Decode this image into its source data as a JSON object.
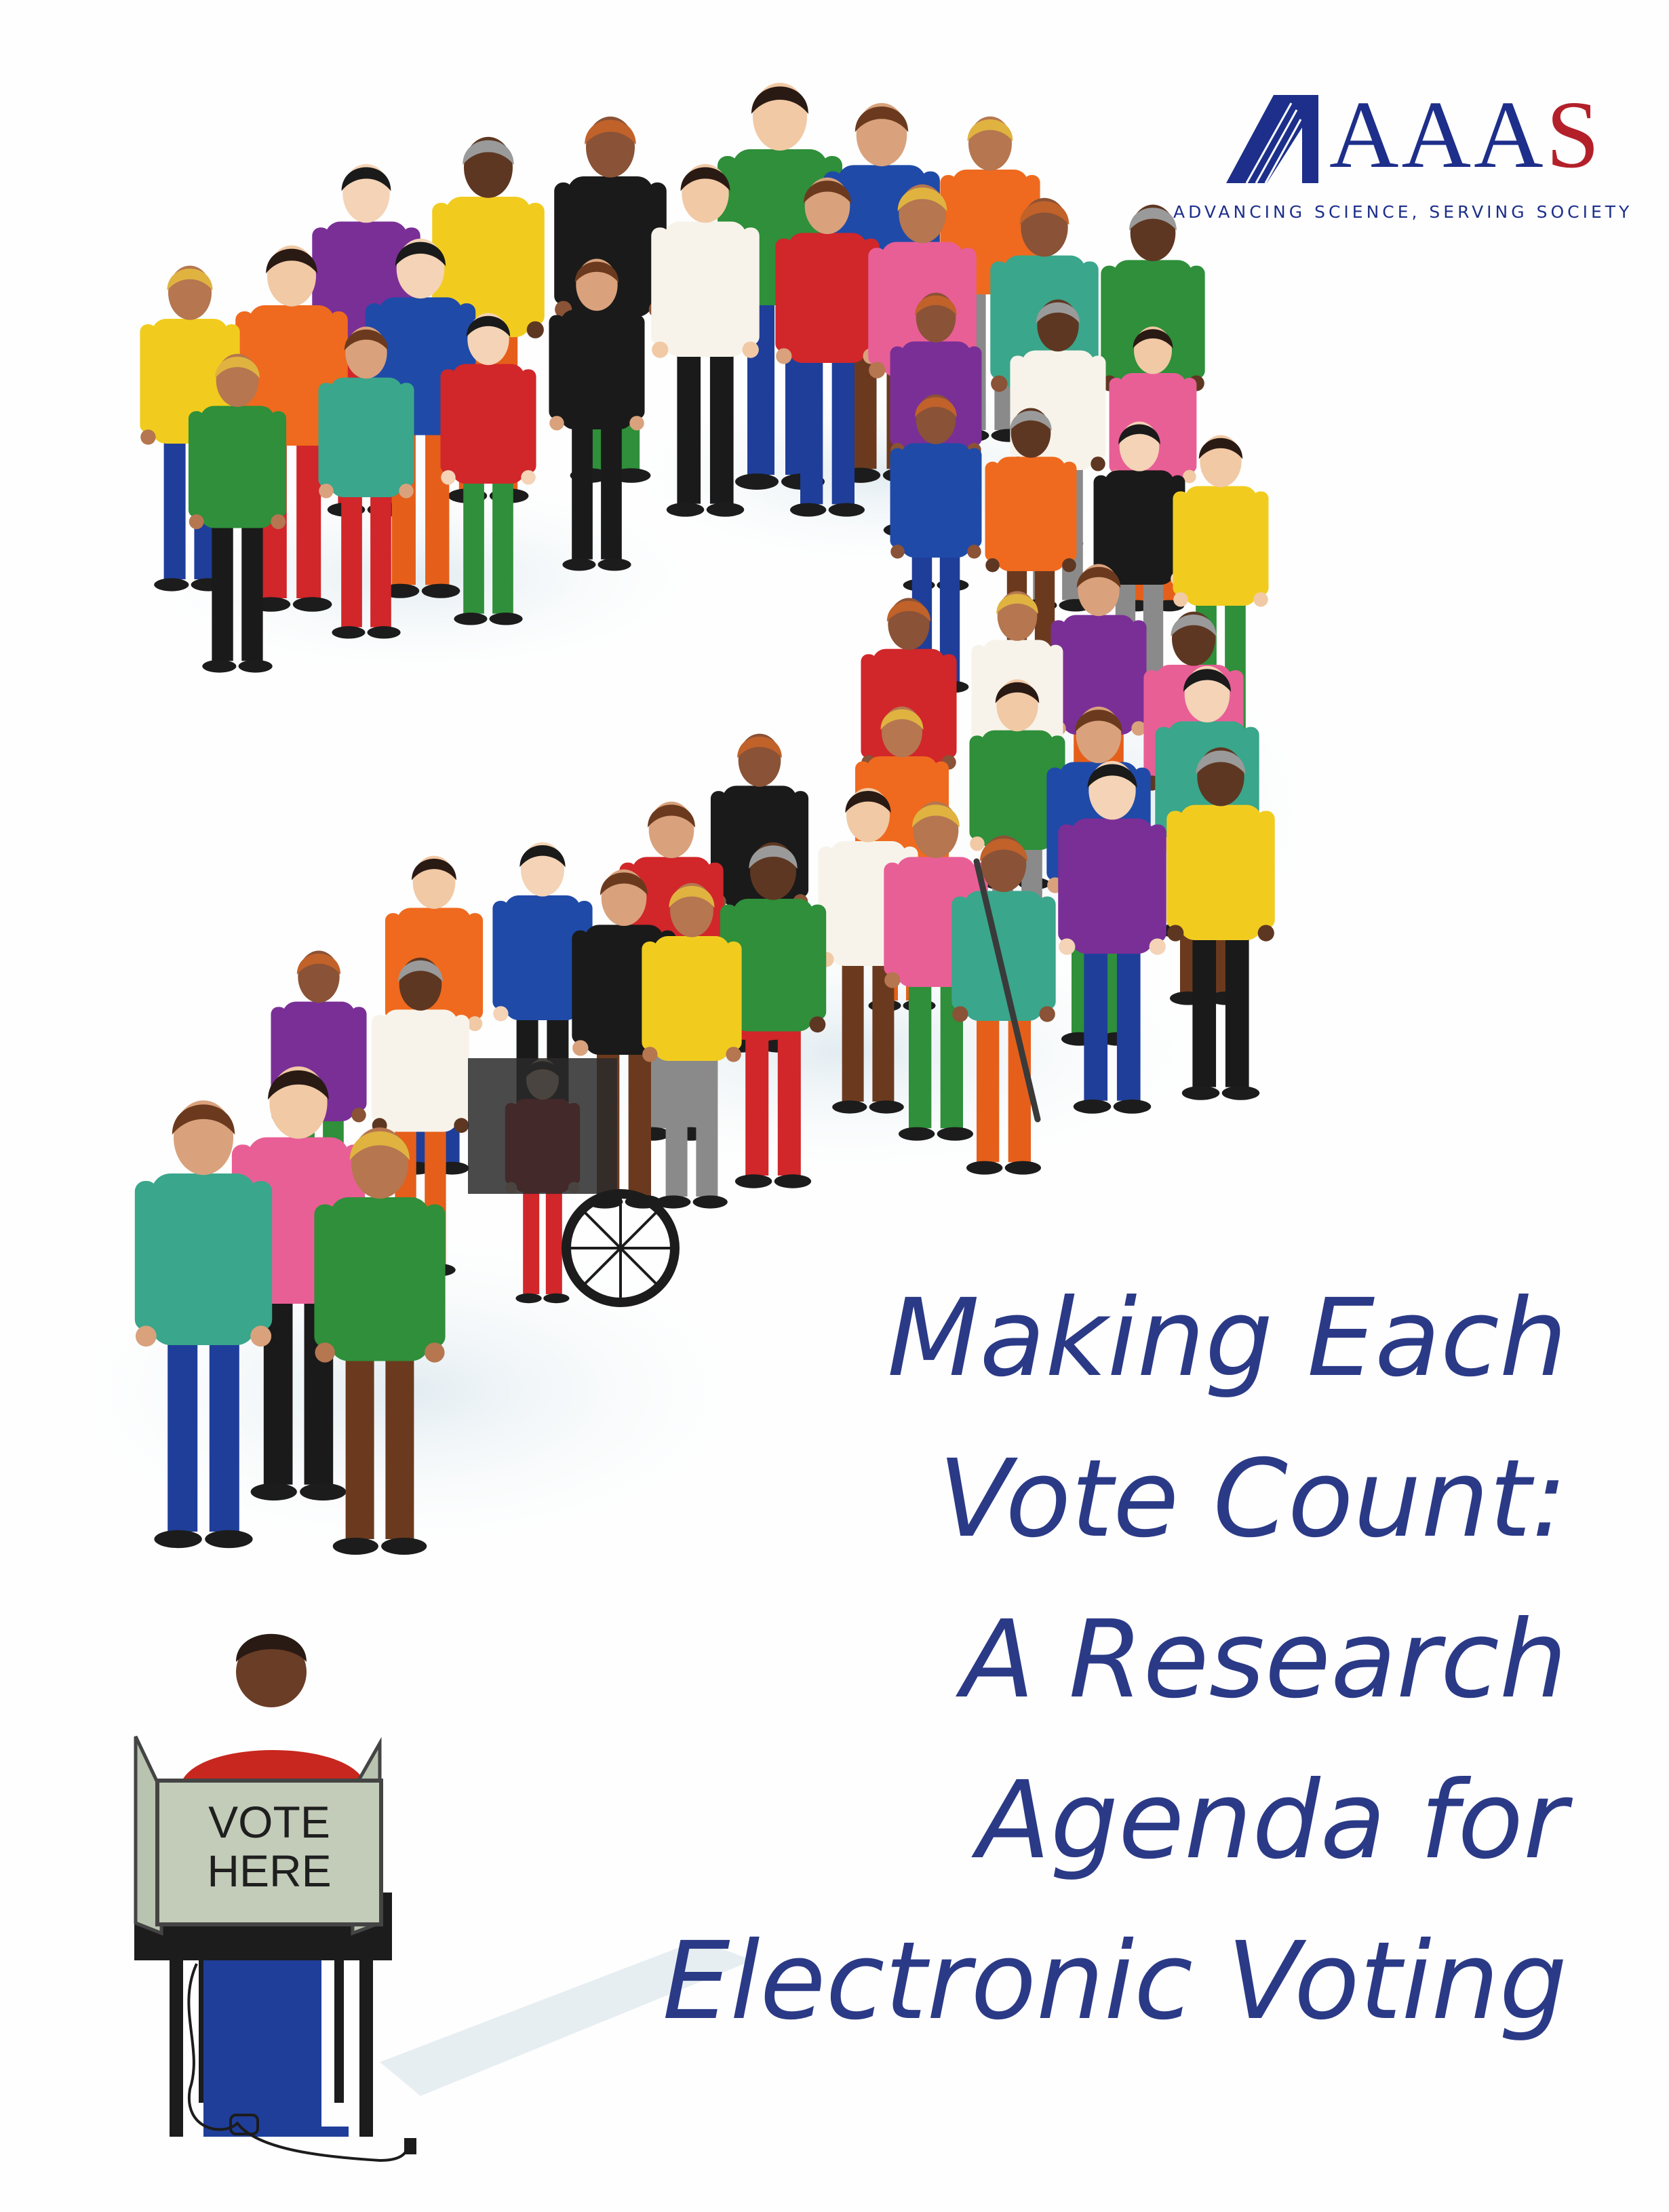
{
  "logo": {
    "wordmark_main": "AAA",
    "wordmark_last": "S",
    "tagline": "ADVANCING SCIENCE, SERVING SOCIETY",
    "colors": {
      "blue": "#1d2f8a",
      "red": "#b3202a"
    }
  },
  "title": {
    "lines": [
      "Making Each",
      "Vote Count:",
      "A Research",
      "Agenda for",
      "Electronic Voting"
    ],
    "color": "#2b3a86"
  },
  "booth": {
    "sign_line1": "VOTE",
    "sign_line2": "HERE"
  },
  "icons": [
    "aaas-logo-icon",
    "voting-booth-icon",
    "wheelchair-icon",
    "cane-icon",
    "power-plug-icon"
  ]
}
